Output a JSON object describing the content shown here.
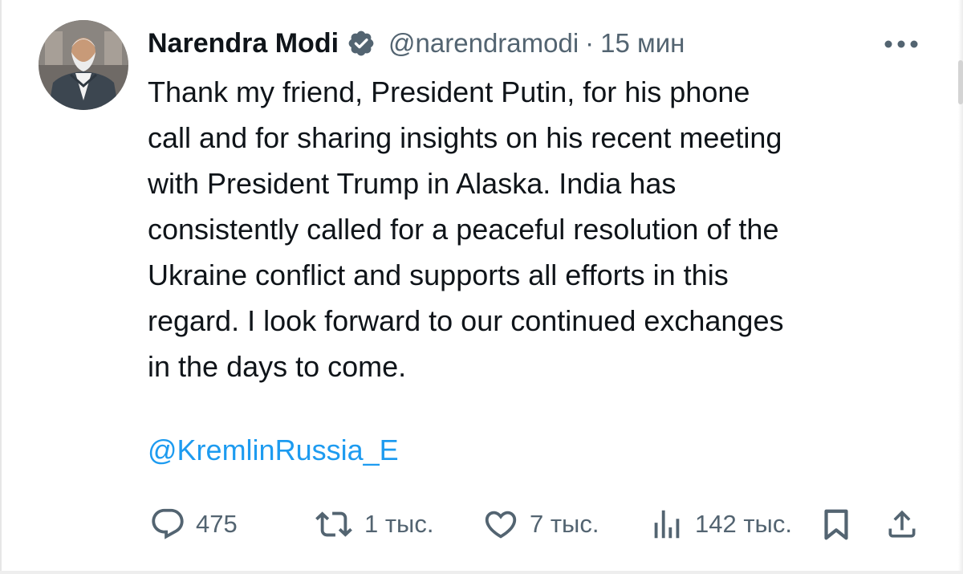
{
  "tweet": {
    "author_name": "Narendra Modi",
    "verified": true,
    "handle": "@narendramodi",
    "separator": "·",
    "time": "15 мин",
    "text_lines": [
      "Thank my friend, President Putin, for his phone",
      "call and for sharing insights on his recent meeting",
      "with President Trump in Alaska. India has",
      "consistently called for a peaceful resolution of the",
      "Ukraine conflict and supports all efforts in this",
      "regard. I look forward to our continued exchanges",
      "in the days to come."
    ],
    "mention": "@KremlinRussia_E"
  },
  "actions": {
    "reply_count": "475",
    "retweet_count": "1 тыс.",
    "like_count": "7 тыс.",
    "views_count": "142 тыс."
  },
  "icons": {
    "verified": "verified-badge-icon",
    "more": "more-dots-icon",
    "reply": "reply-icon",
    "retweet": "retweet-icon",
    "like": "heart-icon",
    "views": "views-icon",
    "bookmark": "bookmark-icon",
    "share": "share-icon"
  },
  "colors": {
    "text": "#0f1419",
    "secondary": "#536471",
    "link": "#1d9bf0",
    "verified_badge": "#536471"
  }
}
